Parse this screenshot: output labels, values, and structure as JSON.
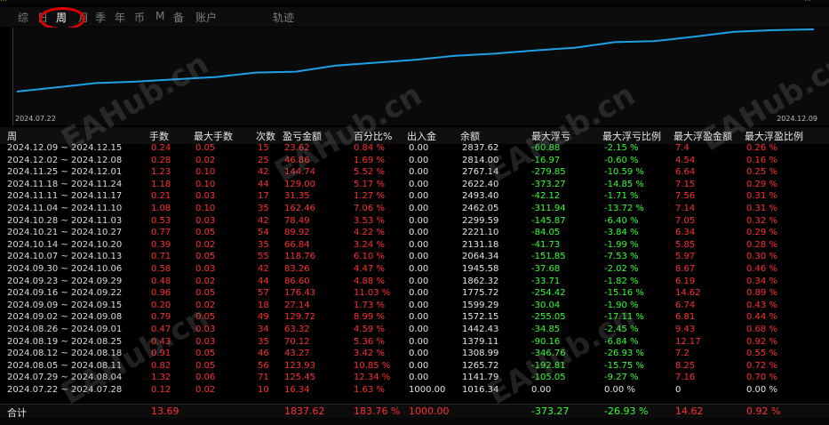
{
  "header_strip": {
    "left_text": "...",
    "right_text": "..."
  },
  "tabs": [
    {
      "label": "综",
      "active": false
    },
    {
      "label": "日",
      "active": false
    },
    {
      "label": "周",
      "active": true
    },
    {
      "label": "月",
      "active": false
    },
    {
      "label": "季",
      "active": false
    },
    {
      "label": "年",
      "active": false
    },
    {
      "label": "币",
      "active": false
    },
    {
      "label": "M",
      "active": false
    },
    {
      "label": "备",
      "active": false
    },
    {
      "label": "账户",
      "active": false
    },
    {
      "label": "轨迹",
      "active": false
    }
  ],
  "colors": {
    "line": "#1ea0e6",
    "red": "#ff3030",
    "green": "#33ff33",
    "highlight": "#e00000"
  },
  "chart": {
    "x_start_label": "2024.07.22",
    "x_end_label": "2024.12.09",
    "balance_series": [
      1016.34,
      1141.79,
      1265.72,
      1308.99,
      1379.11,
      1442.43,
      1572.15,
      1599.29,
      1775.72,
      1862.32,
      1945.58,
      2064.34,
      2131.18,
      2221.1,
      2299.59,
      2462.05,
      2493.4,
      2622.4,
      2767.14,
      2814.0,
      2837.62
    ]
  },
  "columns": [
    "周",
    "手数",
    "最大手数",
    "次数",
    "盈亏金额",
    "百分比%",
    "出入金",
    "余额",
    "最大浮亏",
    "最大浮亏比例",
    "最大浮盈金额",
    "最大浮盈比例"
  ],
  "rows": [
    {
      "week": "2024.12.09 ~ 2024.12.15",
      "lots": "0.24",
      "max_lots": "0.05",
      "count": "15",
      "pnl": "23.62",
      "pct": "0.84 %",
      "io": "0.00",
      "balance": "2837.62",
      "max_dd": "-60.88",
      "max_dd_pct": "-2.15 %",
      "max_fp": "7.4",
      "max_fp_pct": "0.26 %"
    },
    {
      "week": "2024.12.02 ~ 2024.12.08",
      "lots": "0.28",
      "max_lots": "0.02",
      "count": "25",
      "pnl": "46.86",
      "pct": "1.69 %",
      "io": "0.00",
      "balance": "2814.00",
      "max_dd": "-16.97",
      "max_dd_pct": "-0.60 %",
      "max_fp": "4.54",
      "max_fp_pct": "0.16 %"
    },
    {
      "week": "2024.11.25 ~ 2024.12.01",
      "lots": "1.23",
      "max_lots": "0.10",
      "count": "42",
      "pnl": "144.74",
      "pct": "5.52 %",
      "io": "0.00",
      "balance": "2767.14",
      "max_dd": "-279.85",
      "max_dd_pct": "-10.59 %",
      "max_fp": "6.64",
      "max_fp_pct": "0.25 %"
    },
    {
      "week": "2024.11.18 ~ 2024.11.24",
      "lots": "1.18",
      "max_lots": "0.10",
      "count": "44",
      "pnl": "129.00",
      "pct": "5.17 %",
      "io": "0.00",
      "balance": "2622.40",
      "max_dd": "-373.27",
      "max_dd_pct": "-14.85 %",
      "max_fp": "7.15",
      "max_fp_pct": "0.29 %"
    },
    {
      "week": "2024.11.11 ~ 2024.11.17",
      "lots": "0.21",
      "max_lots": "0.03",
      "count": "17",
      "pnl": "31.35",
      "pct": "1.27 %",
      "io": "0.00",
      "balance": "2493.40",
      "max_dd": "-42.12",
      "max_dd_pct": "-1.71 %",
      "max_fp": "7.56",
      "max_fp_pct": "0.31 %"
    },
    {
      "week": "2024.11.04 ~ 2024.11.10",
      "lots": "1.08",
      "max_lots": "0.10",
      "count": "35",
      "pnl": "162.46",
      "pct": "7.06 %",
      "io": "0.00",
      "balance": "2462.05",
      "max_dd": "-311.94",
      "max_dd_pct": "-13.72 %",
      "max_fp": "7.14",
      "max_fp_pct": "0.31 %"
    },
    {
      "week": "2024.10.28 ~ 2024.11.03",
      "lots": "0.53",
      "max_lots": "0.03",
      "count": "42",
      "pnl": "78.49",
      "pct": "3.53 %",
      "io": "0.00",
      "balance": "2299.59",
      "max_dd": "-145.87",
      "max_dd_pct": "-6.40 %",
      "max_fp": "7.05",
      "max_fp_pct": "0.32 %"
    },
    {
      "week": "2024.10.21 ~ 2024.10.27",
      "lots": "0.77",
      "max_lots": "0.05",
      "count": "54",
      "pnl": "89.92",
      "pct": "4.22 %",
      "io": "0.00",
      "balance": "2221.10",
      "max_dd": "-84.05",
      "max_dd_pct": "-3.84 %",
      "max_fp": "6.34",
      "max_fp_pct": "0.29 %"
    },
    {
      "week": "2024.10.14 ~ 2024.10.20",
      "lots": "0.39",
      "max_lots": "0.02",
      "count": "35",
      "pnl": "66.84",
      "pct": "3.24 %",
      "io": "0.00",
      "balance": "2131.18",
      "max_dd": "-41.73",
      "max_dd_pct": "-1.99 %",
      "max_fp": "5.85",
      "max_fp_pct": "0.28 %"
    },
    {
      "week": "2024.10.07 ~ 2024.10.13",
      "lots": "0.71",
      "max_lots": "0.05",
      "count": "55",
      "pnl": "118.76",
      "pct": "6.10 %",
      "io": "0.00",
      "balance": "2064.34",
      "max_dd": "-151.85",
      "max_dd_pct": "-7.53 %",
      "max_fp": "5.97",
      "max_fp_pct": "0.30 %"
    },
    {
      "week": "2024.09.30 ~ 2024.10.06",
      "lots": "0.58",
      "max_lots": "0.03",
      "count": "42",
      "pnl": "83.26",
      "pct": "4.47 %",
      "io": "0.00",
      "balance": "1945.58",
      "max_dd": "-37.68",
      "max_dd_pct": "-2.02 %",
      "max_fp": "8.67",
      "max_fp_pct": "0.46 %"
    },
    {
      "week": "2024.09.23 ~ 2024.09.29",
      "lots": "0.48",
      "max_lots": "0.02",
      "count": "44",
      "pnl": "86.60",
      "pct": "4.88 %",
      "io": "0.00",
      "balance": "1862.32",
      "max_dd": "-33.71",
      "max_dd_pct": "-1.82 %",
      "max_fp": "6.19",
      "max_fp_pct": "0.34 %"
    },
    {
      "week": "2024.09.16 ~ 2024.09.22",
      "lots": "0.96",
      "max_lots": "0.05",
      "count": "57",
      "pnl": "176.43",
      "pct": "11.03 %",
      "io": "0.00",
      "balance": "1775.72",
      "max_dd": "-254.42",
      "max_dd_pct": "-15.16 %",
      "max_fp": "14.62",
      "max_fp_pct": "0.89 %"
    },
    {
      "week": "2024.09.09 ~ 2024.09.15",
      "lots": "0.20",
      "max_lots": "0.02",
      "count": "18",
      "pnl": "27.14",
      "pct": "1.73 %",
      "io": "0.00",
      "balance": "1599.29",
      "max_dd": "-30.04",
      "max_dd_pct": "-1.90 %",
      "max_fp": "6.74",
      "max_fp_pct": "0.43 %"
    },
    {
      "week": "2024.09.02 ~ 2024.09.08",
      "lots": "0.79",
      "max_lots": "0.05",
      "count": "49",
      "pnl": "129.72",
      "pct": "8.99 %",
      "io": "0.00",
      "balance": "1572.15",
      "max_dd": "-255.05",
      "max_dd_pct": "-17.11 %",
      "max_fp": "6.81",
      "max_fp_pct": "0.44 %"
    },
    {
      "week": "2024.08.26 ~ 2024.09.01",
      "lots": "0.47",
      "max_lots": "0.03",
      "count": "34",
      "pnl": "63.32",
      "pct": "4.59 %",
      "io": "0.00",
      "balance": "1442.43",
      "max_dd": "-34.85",
      "max_dd_pct": "-2.45 %",
      "max_fp": "9.43",
      "max_fp_pct": "0.68 %"
    },
    {
      "week": "2024.08.19 ~ 2024.08.25",
      "lots": "0.43",
      "max_lots": "0.03",
      "count": "35",
      "pnl": "70.12",
      "pct": "5.36 %",
      "io": "0.00",
      "balance": "1379.11",
      "max_dd": "-90.16",
      "max_dd_pct": "-6.84 %",
      "max_fp": "12.17",
      "max_fp_pct": "0.92 %"
    },
    {
      "week": "2024.08.12 ~ 2024.08.18",
      "lots": "0.91",
      "max_lots": "0.05",
      "count": "46",
      "pnl": "43.27",
      "pct": "3.42 %",
      "io": "0.00",
      "balance": "1308.99",
      "max_dd": "-346.76",
      "max_dd_pct": "-26.93 %",
      "max_fp": "7.2",
      "max_fp_pct": "0.55 %"
    },
    {
      "week": "2024.08.05 ~ 2024.08.11",
      "lots": "0.82",
      "max_lots": "0.05",
      "count": "56",
      "pnl": "123.93",
      "pct": "10.85 %",
      "io": "0.00",
      "balance": "1265.72",
      "max_dd": "-192.81",
      "max_dd_pct": "-15.75 %",
      "max_fp": "8.25",
      "max_fp_pct": "0.72 %"
    },
    {
      "week": "2024.07.29 ~ 2024.08.04",
      "lots": "1.32",
      "max_lots": "0.06",
      "count": "71",
      "pnl": "125.45",
      "pct": "12.34 %",
      "io": "0.00",
      "balance": "1141.79",
      "max_dd": "-105.05",
      "max_dd_pct": "-9.27 %",
      "max_fp": "7.16",
      "max_fp_pct": "0.70 %"
    },
    {
      "week": "2024.07.22 ~ 2024.07.28",
      "lots": "0.12",
      "max_lots": "0.02",
      "count": "10",
      "pnl": "16.34",
      "pct": "1.63 %",
      "io": "1000.00",
      "balance": "1016.34",
      "max_dd": "0.00",
      "max_dd_pct": "0.00 %",
      "max_fp": "0",
      "max_fp_pct": "0.00 %"
    }
  ],
  "total": {
    "label": "合计",
    "lots": "13.69",
    "pnl": "1837.62",
    "pct": "183.76 %",
    "io": "1000.00",
    "max_dd": "-373.27",
    "max_dd_pct": "-26.93 %",
    "max_fp": "14.62",
    "max_fp_pct": "0.92 %"
  },
  "watermark": "EAHub.cn"
}
